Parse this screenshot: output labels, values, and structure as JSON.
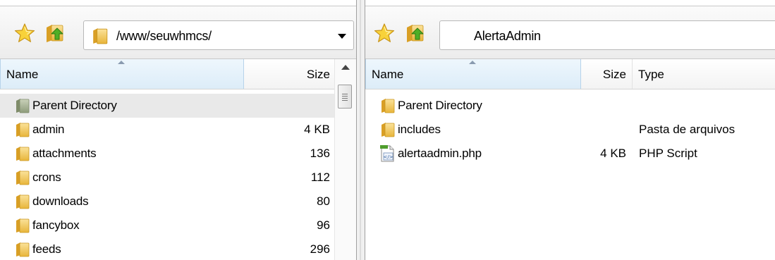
{
  "left": {
    "path": "/www/seuwhmcs/",
    "columns": {
      "name": "Name",
      "size": "Size"
    },
    "rows": [
      {
        "name": "Parent Directory",
        "size": "",
        "icon": "parent-folder-icon"
      },
      {
        "name": "admin",
        "size": "4 KB",
        "icon": "folder-icon"
      },
      {
        "name": "attachments",
        "size": "136",
        "icon": "folder-icon"
      },
      {
        "name": "crons",
        "size": "112",
        "icon": "folder-icon"
      },
      {
        "name": "downloads",
        "size": "80",
        "icon": "folder-icon"
      },
      {
        "name": "fancybox",
        "size": "96",
        "icon": "folder-icon"
      },
      {
        "name": "feeds",
        "size": "296",
        "icon": "folder-icon"
      }
    ]
  },
  "right": {
    "path": "AlertaAdmin",
    "columns": {
      "name": "Name",
      "size": "Size",
      "type": "Type"
    },
    "rows": [
      {
        "name": "Parent Directory",
        "size": "",
        "type": "",
        "icon": "folder-icon"
      },
      {
        "name": "includes",
        "size": "",
        "type": "Pasta de arquivos",
        "icon": "folder-icon"
      },
      {
        "name": "alertaadmin.php",
        "size": "4 KB",
        "type": "PHP Script",
        "icon": "php-file-icon"
      }
    ]
  },
  "colors": {
    "folder": "#f2c94c",
    "folder_dark": "#d4a017",
    "star": "#f5c518",
    "arrow_green": "#3d9a1c",
    "selected_row": "#e9e9e9"
  }
}
